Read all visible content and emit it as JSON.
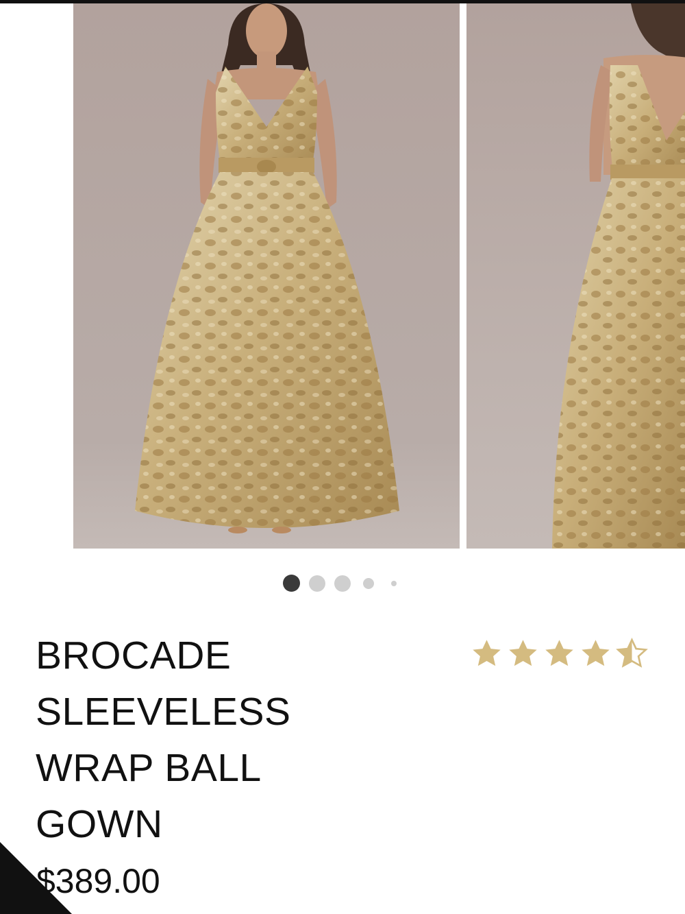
{
  "product": {
    "images": [
      {
        "alt": "Gold brocade sleeveless wrap ball gown, front view"
      },
      {
        "alt": "Gold brocade sleeveless wrap ball gown, back view"
      }
    ],
    "carousel": {
      "total": 5,
      "active_index": 1
    },
    "title": "BROCADE SLEEVELESS WRAP BALL GOWN",
    "title_lines": [
      "BROCADE",
      "SLEEVELESS",
      "WRAP BALL",
      "GOWN"
    ],
    "price": "$389.00",
    "rating": {
      "value": 4.5,
      "max": 5
    }
  },
  "colors": {
    "star": "#d4bb80",
    "backdrop": "#b3a6a0",
    "gown": "#cdb88c",
    "text": "#111111"
  }
}
